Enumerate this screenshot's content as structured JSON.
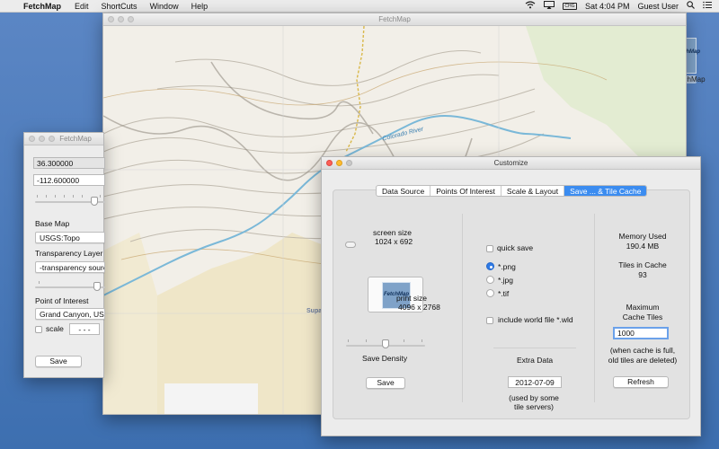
{
  "menubar": {
    "app_name": "FetchMap",
    "menus": [
      "Edit",
      "ShortCuts",
      "Window",
      "Help"
    ],
    "clock": "Sat 4:04 PM",
    "user": "Guest User",
    "battery_label": "CHG"
  },
  "desktop_icon": {
    "label": "FetchMap",
    "logo_text": "FetchMap"
  },
  "map_window": {
    "title": "FetchMap",
    "river_label": "Colorado River",
    "place_label": "Supai"
  },
  "controls_window": {
    "title": "FetchMap",
    "latitude": "36.300000",
    "longitude": "-112.600000",
    "base_map_label": "Base Map",
    "base_map_value": "USGS:Topo",
    "transparency_label": "Transparency Layer",
    "transparency_value": "-transparency source-",
    "poi_label": "Point of Interest",
    "poi_value": "Grand Canyon, USA",
    "scale_label": "scale",
    "scale_value": "- - -",
    "save_label": "Save"
  },
  "customize_window": {
    "title": "Customize",
    "tabs": [
      "Data Source",
      "Points Of Interest",
      "Scale & Layout",
      "Save ... & Tile Cache"
    ],
    "selected_tab": 3,
    "screen_size_label": "screen size",
    "screen_size_value": "1024 x 692",
    "thumb_logo": "FetchMap",
    "print_size_label": "print size",
    "print_size_value": "4096 x 2768",
    "save_density_label": "Save Density",
    "save_button": "Save",
    "quick_save_label": "quick save",
    "formats": [
      "*.png",
      "*.jpg",
      "*.tif"
    ],
    "selected_format": 0,
    "world_file_label": "include world file *.wld",
    "extra_data_label": "Extra Data",
    "extra_data_value": "2012-07-09",
    "extra_data_note_1": "(used by some",
    "extra_data_note_2": "tile servers)",
    "memory_used_label": "Memory Used",
    "memory_used_value": "190.4 MB",
    "tiles_label": "Tiles in Cache",
    "tiles_value": "93",
    "max_cache_label_1": "Maximum",
    "max_cache_label_2": "Cache Tiles",
    "max_cache_value": "1000",
    "cache_note_1": "(when cache is full,",
    "cache_note_2": "old tiles are deleted)",
    "refresh_button": "Refresh"
  },
  "colors": {
    "desktop": "#4a78b6",
    "accent": "#3b8cf0",
    "map_terrain": "#f3efe4",
    "river": "#7ab8d8"
  }
}
